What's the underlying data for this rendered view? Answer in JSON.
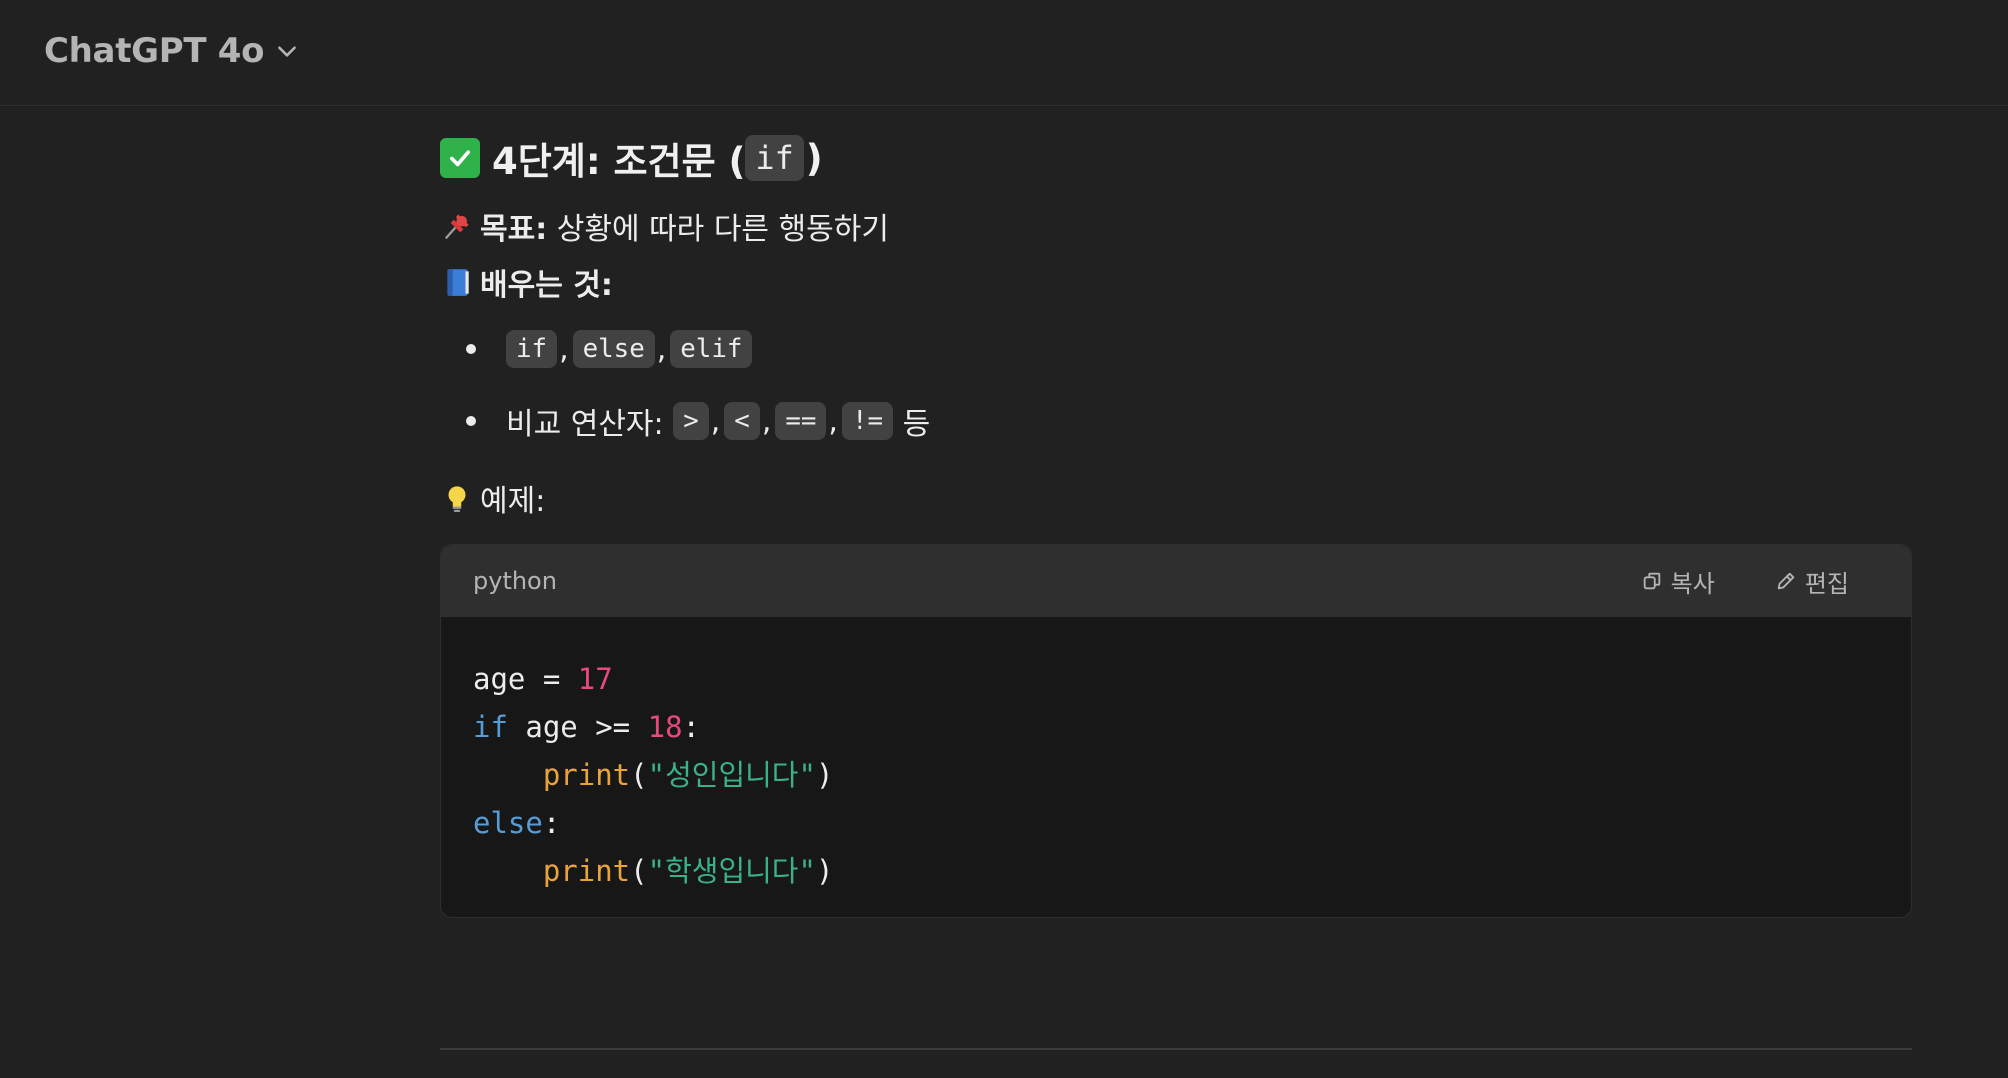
{
  "header": {
    "model_label": "ChatGPT 4o",
    "chevron_icon": "chevron-down-icon"
  },
  "message": {
    "heading_prefix": "4단계: 조건문 (",
    "heading_code": "if",
    "heading_suffix": ")",
    "goal_label": "목표:",
    "goal_text": "상황에 따라 다른 행동하기",
    "learn_label": "배우는 것:",
    "bullet1": {
      "codes": [
        "if",
        "else",
        "elif"
      ]
    },
    "bullet2": {
      "prefix": "비교 연산자:",
      "codes": [
        ">",
        "<",
        "==",
        "!="
      ],
      "suffix": "등"
    },
    "example_label": "예제:"
  },
  "code_block": {
    "language": "python",
    "copy_label": "복사",
    "edit_label": "편집",
    "lines": {
      "l1_var": "age = ",
      "l1_num": "17",
      "l2_kw": "if",
      "l2_mid": " age >= ",
      "l2_num": "18",
      "l2_end": ":",
      "l3_indent": "    ",
      "l3_fn": "print",
      "l3_open": "(",
      "l3_str": "\"성인입니다\"",
      "l3_close": ")",
      "l4_kw": "else",
      "l4_end": ":",
      "l5_indent": "    ",
      "l5_fn": "print",
      "l5_open": "(",
      "l5_str": "\"학생입니다\"",
      "l5_close": ")"
    }
  },
  "colors": {
    "background": "#212121",
    "keyword": "#569cd6",
    "number": "#e44b7a",
    "function": "#e8a33d",
    "string": "#3bb18a"
  }
}
